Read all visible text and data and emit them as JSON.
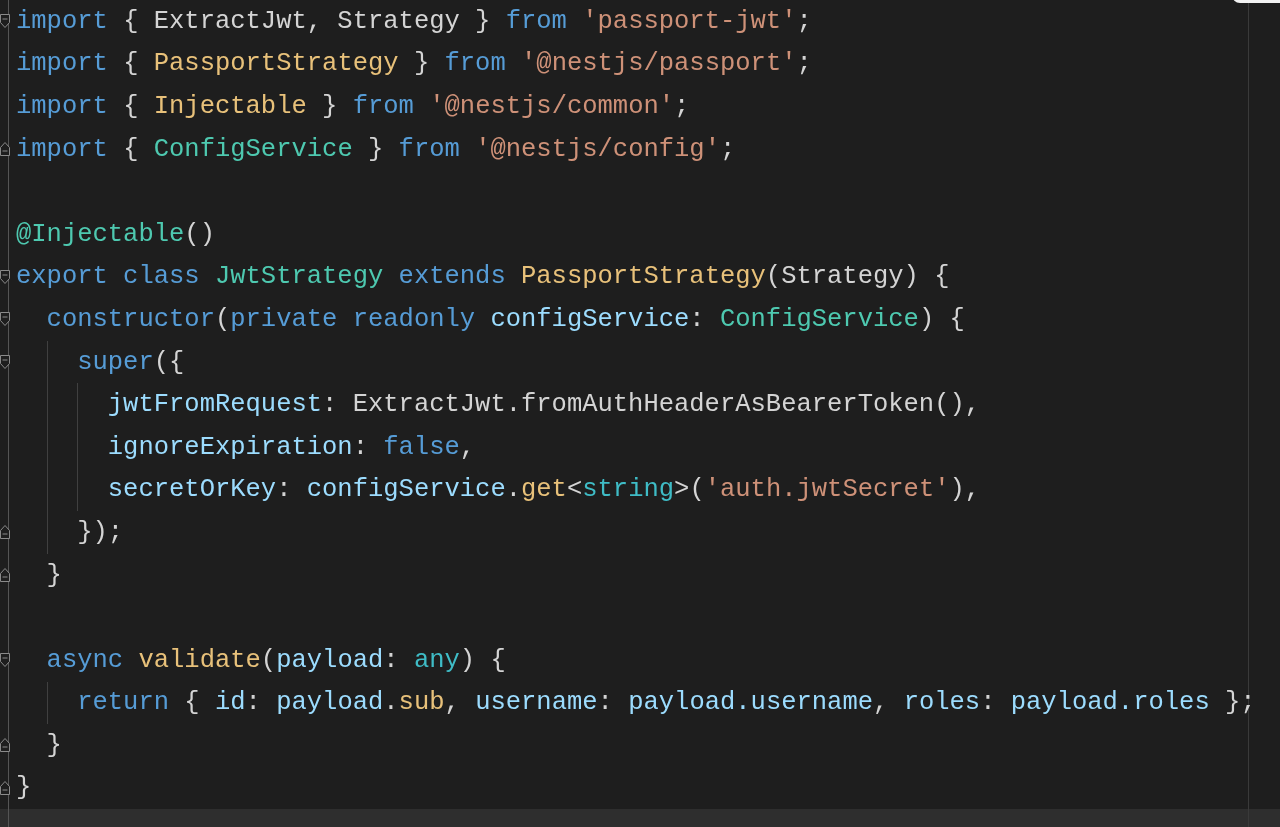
{
  "editor": {
    "lines": [
      {
        "fold_start": true,
        "fold_end": false,
        "current_line": false,
        "tokens": [
          {
            "kind": "keyword",
            "text": "import"
          },
          {
            "kind": "plain",
            "text": " { ExtractJwt, Strategy } "
          },
          {
            "kind": "keyword",
            "text": "from"
          },
          {
            "kind": "string",
            "text": " 'passport-jwt'"
          },
          {
            "kind": "plain",
            "text": ";"
          }
        ]
      },
      {
        "fold_start": false,
        "fold_end": false,
        "current_line": false,
        "tokens": [
          {
            "kind": "keyword",
            "text": "import"
          },
          {
            "kind": "plain",
            "text": " { "
          },
          {
            "kind": "function",
            "text": "PassportStrategy"
          },
          {
            "kind": "plain",
            "text": " } "
          },
          {
            "kind": "keyword",
            "text": "from"
          },
          {
            "kind": "string",
            "text": " '@nestjs/passport'"
          },
          {
            "kind": "plain",
            "text": ";"
          }
        ]
      },
      {
        "fold_start": false,
        "fold_end": false,
        "current_line": false,
        "tokens": [
          {
            "kind": "keyword",
            "text": "import"
          },
          {
            "kind": "plain",
            "text": " { "
          },
          {
            "kind": "function",
            "text": "Injectable"
          },
          {
            "kind": "plain",
            "text": " } "
          },
          {
            "kind": "keyword",
            "text": "from"
          },
          {
            "kind": "string",
            "text": " '@nestjs/common'"
          },
          {
            "kind": "plain",
            "text": ";"
          }
        ]
      },
      {
        "fold_start": false,
        "fold_end": true,
        "current_line": false,
        "tokens": [
          {
            "kind": "keyword",
            "text": "import"
          },
          {
            "kind": "plain",
            "text": " { "
          },
          {
            "kind": "type",
            "text": "ConfigService"
          },
          {
            "kind": "plain",
            "text": " } "
          },
          {
            "kind": "keyword",
            "text": "from"
          },
          {
            "kind": "string",
            "text": " '@nestjs/config'"
          },
          {
            "kind": "plain",
            "text": ";"
          }
        ]
      },
      {
        "fold_start": false,
        "fold_end": false,
        "current_line": false
      },
      {
        "fold_start": false,
        "fold_end": false,
        "current_line": false,
        "tokens": [
          {
            "kind": "type",
            "text": "@Injectable"
          },
          {
            "kind": "plain",
            "text": "()"
          }
        ]
      },
      {
        "fold_start": true,
        "fold_end": false,
        "current_line": false,
        "tokens": [
          {
            "kind": "keyword",
            "text": "export class"
          },
          {
            "kind": "type",
            "text": " JwtStrategy"
          },
          {
            "kind": "keyword",
            "text": " extends"
          },
          {
            "kind": "function",
            "text": " PassportStrategy"
          },
          {
            "kind": "plain",
            "text": "(Strategy) {"
          }
        ]
      },
      {
        "fold_start": true,
        "fold_end": false,
        "current_line": false,
        "tokens": [
          {
            "kind": "keyword",
            "text": "  constructor"
          },
          {
            "kind": "plain",
            "text": "("
          },
          {
            "kind": "keyword",
            "text": "private readonly"
          },
          {
            "kind": "property",
            "text": " configService"
          },
          {
            "kind": "plain",
            "text": ": "
          },
          {
            "kind": "type",
            "text": "ConfigService"
          },
          {
            "kind": "plain",
            "text": ") {"
          }
        ]
      },
      {
        "fold_start": true,
        "fold_end": false,
        "current_line": false,
        "tokens": [
          {
            "kind": "keyword",
            "text": "    super"
          },
          {
            "kind": "plain",
            "text": "({"
          }
        ]
      },
      {
        "fold_start": false,
        "fold_end": false,
        "current_line": false,
        "tokens": [
          {
            "kind": "property",
            "text": "      jwtFromRequest"
          },
          {
            "kind": "plain",
            "text": ": ExtractJwt.fromAuthHeaderAsBearerToken(),"
          }
        ]
      },
      {
        "fold_start": false,
        "fold_end": false,
        "current_line": false,
        "tokens": [
          {
            "kind": "property",
            "text": "      ignoreExpiration"
          },
          {
            "kind": "plain",
            "text": ": "
          },
          {
            "kind": "keyword",
            "text": "false"
          },
          {
            "kind": "plain",
            "text": ","
          }
        ]
      },
      {
        "fold_start": false,
        "fold_end": false,
        "current_line": false,
        "tokens": [
          {
            "kind": "property",
            "text": "      secretOrKey"
          },
          {
            "kind": "plain",
            "text": ": "
          },
          {
            "kind": "property",
            "text": "configService"
          },
          {
            "kind": "plain",
            "text": "."
          },
          {
            "kind": "function",
            "text": "get"
          },
          {
            "kind": "plain",
            "text": "<"
          },
          {
            "kind": "builtin",
            "text": "string"
          },
          {
            "kind": "plain",
            "text": ">("
          },
          {
            "kind": "string",
            "text": "'auth.jwtSecret'"
          },
          {
            "kind": "plain",
            "text": "),"
          }
        ]
      },
      {
        "fold_start": false,
        "fold_end": true,
        "current_line": false,
        "tokens": [
          {
            "kind": "plain",
            "text": "    });"
          }
        ]
      },
      {
        "fold_start": false,
        "fold_end": true,
        "current_line": false,
        "tokens": [
          {
            "kind": "plain",
            "text": "  }"
          }
        ]
      },
      {
        "fold_start": false,
        "fold_end": false,
        "current_line": false
      },
      {
        "fold_start": true,
        "fold_end": false,
        "current_line": false,
        "tokens": [
          {
            "kind": "keyword",
            "text": "  async"
          },
          {
            "kind": "function",
            "text": " validate"
          },
          {
            "kind": "plain",
            "text": "("
          },
          {
            "kind": "property",
            "text": "payload"
          },
          {
            "kind": "plain",
            "text": ": "
          },
          {
            "kind": "builtin",
            "text": "any"
          },
          {
            "kind": "plain",
            "text": ") {"
          }
        ]
      },
      {
        "fold_start": false,
        "fold_end": false,
        "current_line": false,
        "tokens": [
          {
            "kind": "keyword",
            "text": "    return"
          },
          {
            "kind": "plain",
            "text": " { "
          },
          {
            "kind": "property",
            "text": "id"
          },
          {
            "kind": "plain",
            "text": ": "
          },
          {
            "kind": "property",
            "text": "payload"
          },
          {
            "kind": "plain",
            "text": "."
          },
          {
            "kind": "function",
            "text": "sub"
          },
          {
            "kind": "plain",
            "text": ", "
          },
          {
            "kind": "property",
            "text": "username"
          },
          {
            "kind": "plain",
            "text": ": "
          },
          {
            "kind": "property",
            "text": "payload.username"
          },
          {
            "kind": "plain",
            "text": ", "
          },
          {
            "kind": "property",
            "text": "roles"
          },
          {
            "kind": "plain",
            "text": ": "
          },
          {
            "kind": "property",
            "text": "payload.roles"
          },
          {
            "kind": "plain",
            "text": " };"
          }
        ]
      },
      {
        "fold_start": false,
        "fold_end": true,
        "current_line": false,
        "tokens": [
          {
            "kind": "plain",
            "text": "  }"
          }
        ]
      },
      {
        "fold_start": false,
        "fold_end": true,
        "current_line": false,
        "tokens": [
          {
            "kind": "plain",
            "text": "}"
          }
        ]
      },
      {
        "fold_start": false,
        "fold_end": false,
        "current_line": true
      }
    ]
  }
}
